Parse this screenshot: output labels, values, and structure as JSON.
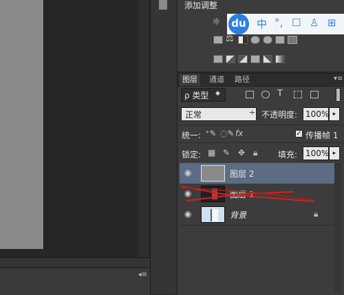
{
  "canvas": {},
  "adjustments": {
    "title": "添加调整",
    "icons": [
      "brightness-contrast-icon",
      "levels-icon",
      "curves-icon",
      "exposure-icon",
      "vibrance-icon",
      "hue-saturation-icon",
      "color-balance-icon",
      "black-white-icon",
      "photo-filter-icon",
      "channel-mixer-icon",
      "color-lookup-icon",
      "invert-icon",
      "posterize-icon",
      "threshold-icon",
      "selective-color-icon",
      "gradient-map-icon"
    ]
  },
  "baidu": {
    "logo": "du",
    "items": [
      "中",
      "°,",
      "☐",
      "♙",
      "⊞"
    ]
  },
  "layers_panel": {
    "tabs": [
      "图层",
      "通道",
      "路径"
    ],
    "filter": {
      "label": "ρ 类型"
    },
    "blend_mode": "正常",
    "opacity_label": "不透明度:",
    "opacity_value": "100%",
    "unify_label": "统一:",
    "propagate_label": "传播帧 1",
    "lock_label": "锁定:",
    "fill_label": "填充:",
    "fill_value": "100%",
    "layers": [
      {
        "name": "图层 2",
        "selected": true,
        "visible": true
      },
      {
        "name": "图层 1",
        "selected": false,
        "visible": true
      },
      {
        "name": "背景",
        "selected": false,
        "visible": true,
        "locked": true
      }
    ]
  },
  "colors": {
    "selected_row": "#5c6c85",
    "strike": "#d0221f",
    "baidu_blue": "#2b7fe3"
  }
}
